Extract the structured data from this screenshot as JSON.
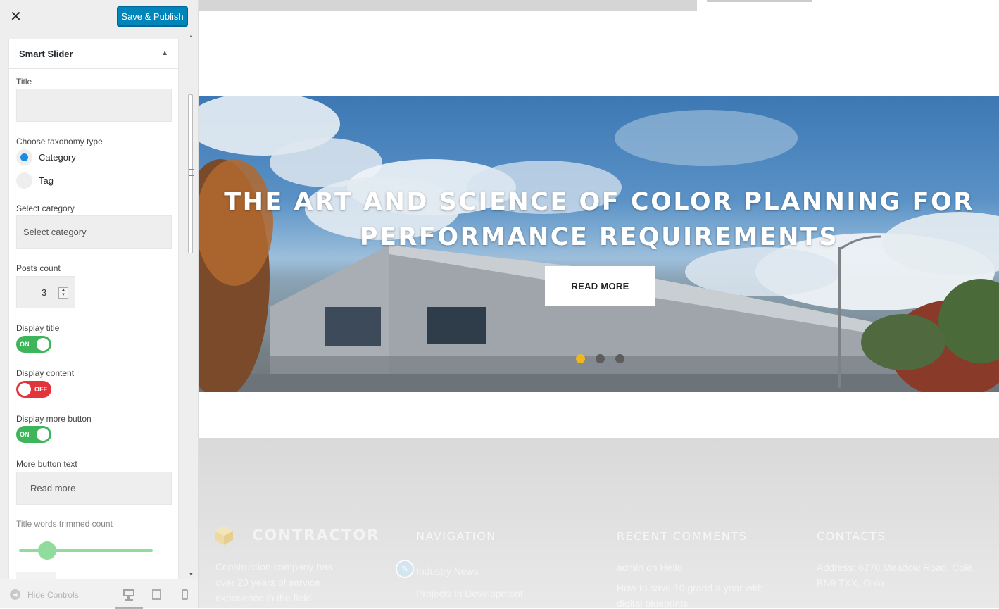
{
  "header": {
    "close_label": "✕",
    "publish_label": "Save & Publish"
  },
  "widget": {
    "title": "Smart Slider",
    "title_label": "Title",
    "title_value": "",
    "taxonomy_label": "Choose taxonomy type",
    "taxonomy_options": [
      "Category",
      "Tag"
    ],
    "taxonomy_selected": "Category",
    "category_label": "Select category",
    "category_value": "Select category",
    "posts_count_label": "Posts count",
    "posts_count_value": "3",
    "display_title_label": "Display title",
    "display_title_state": "ON",
    "display_content_label": "Display content",
    "display_content_state": "OFF",
    "display_more_label": "Display more button",
    "display_more_state": "ON",
    "more_text_label": "More button text",
    "more_text_value": "Read more",
    "trim_label": "Title words trimmed count"
  },
  "footer_controls": {
    "hide_label": "Hide Controls",
    "devices": [
      "desktop-icon",
      "tablet-icon",
      "mobile-icon"
    ],
    "active_device": "desktop"
  },
  "hero": {
    "title": "THE ART AND SCIENCE OF COLOR PLANNING FOR PERFORMANCE REQUIREMENTS",
    "button_label": "READ MORE",
    "slides": 3,
    "active_slide": 1
  },
  "site_footer": {
    "brand": "CONTRACTOR",
    "about_text": [
      "Construction company has",
      "over 20 years of service",
      "experience in the field."
    ],
    "nav_heading": "NAVIGATION",
    "nav_items": [
      "Industry News",
      "Projects in Development"
    ],
    "comments_heading": "RECENT COMMENTS",
    "comments": [
      "admin on Hello",
      "How to save 10 grand a year with",
      "digital blueprints"
    ],
    "contacts_heading": "CONTACTS",
    "contacts": [
      "Address: 6770 Meadow Road, Cole,",
      "BN9 TXX, Ohio"
    ]
  },
  "colors": {
    "accent": "#0085ba",
    "toggle_on": "#3eb55b",
    "toggle_off": "#e2353b",
    "dot_active": "#f0b71d"
  }
}
